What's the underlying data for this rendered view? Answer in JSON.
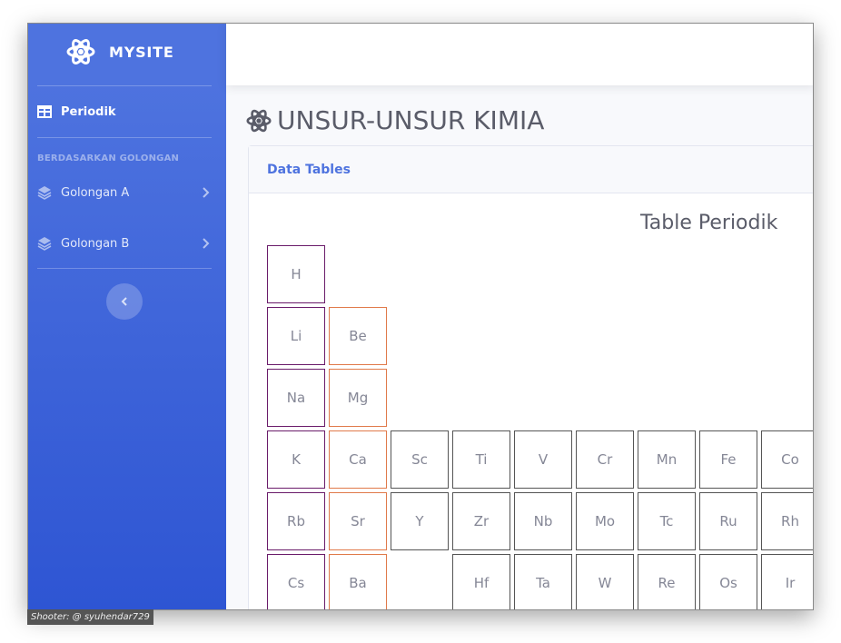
{
  "brand": {
    "name": "MYSITE"
  },
  "sidebar": {
    "active_item": {
      "label": "Periodik"
    },
    "heading": "BERDASARKAN GOLONGAN",
    "items": [
      {
        "label": "Golongan A"
      },
      {
        "label": "Golongan B"
      }
    ]
  },
  "page": {
    "title": "UNSUR-UNSUR KIMIA",
    "card_title": "Data Tables",
    "table_title": "Table Periodik"
  },
  "elements": [
    [
      "H"
    ],
    [
      "Li",
      "Be"
    ],
    [
      "Na",
      "Mg"
    ],
    [
      "K",
      "Ca",
      "Sc",
      "Ti",
      "V",
      "Cr",
      "Mn",
      "Fe",
      "Co"
    ],
    [
      "Rb",
      "Sr",
      "Y",
      "Zr",
      "Nb",
      "Mo",
      "Tc",
      "Ru",
      "Rh"
    ],
    [
      "Cs",
      "Ba",
      "",
      "Hf",
      "Ta",
      "W",
      "Re",
      "Os",
      "Ir"
    ]
  ],
  "watermark": "Shooter: @ syuhendar729",
  "colors": {
    "sidebar_top": "#4e73df",
    "sidebar_bottom": "#2e55d3",
    "accent": "#4e73df",
    "group1_border": "#6a1b6a",
    "group2_border": "#e07a4a"
  }
}
